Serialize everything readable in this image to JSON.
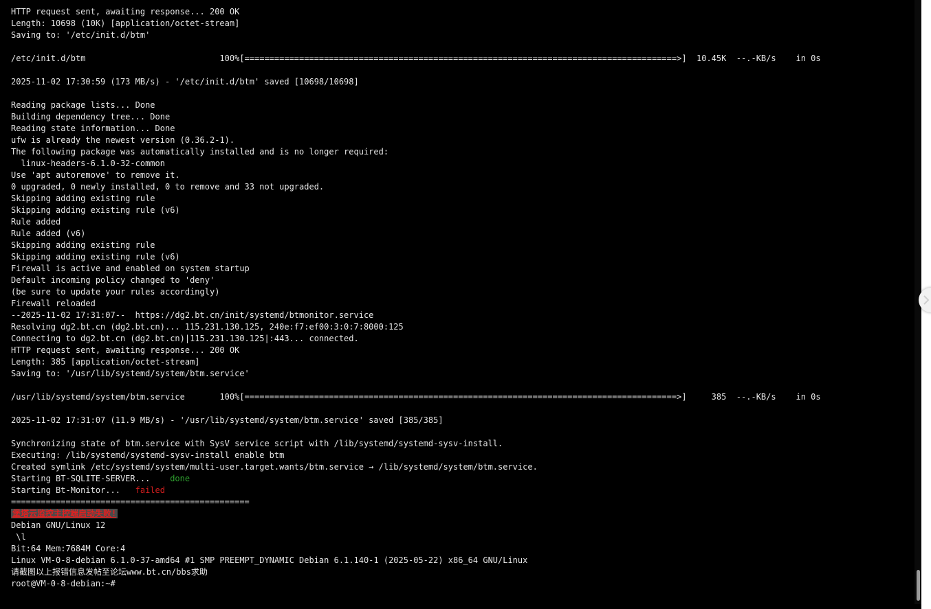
{
  "terminal": {
    "lines": [
      "HTTP request sent, awaiting response... 200 OK",
      "Length: 10698 (10K) [application/octet-stream]",
      "Saving to: '/etc/init.d/btm'",
      "",
      "/etc/init.d/btm                           100%[=======================================================================================>]  10.45K  --.-KB/s    in 0s",
      "",
      "2025-11-02 17:30:59 (173 MB/s) - '/etc/init.d/btm' saved [10698/10698]",
      "",
      "Reading package lists... Done",
      "Building dependency tree... Done",
      "Reading state information... Done",
      "ufw is already the newest version (0.36.2-1).",
      "The following package was automatically installed and is no longer required:",
      "  linux-headers-6.1.0-32-common",
      "Use 'apt autoremove' to remove it.",
      "0 upgraded, 0 newly installed, 0 to remove and 33 not upgraded.",
      "Skipping adding existing rule",
      "Skipping adding existing rule (v6)",
      "Rule added",
      "Rule added (v6)",
      "Skipping adding existing rule",
      "Skipping adding existing rule (v6)",
      "Firewall is active and enabled on system startup",
      "Default incoming policy changed to 'deny'",
      "(be sure to update your rules accordingly)",
      "Firewall reloaded",
      "--2025-11-02 17:31:07--  https://dg2.bt.cn/init/systemd/btmonitor.service",
      "Resolving dg2.bt.cn (dg2.bt.cn)... 115.231.130.125, 240e:f7:ef00:3:0:7:8000:125",
      "Connecting to dg2.bt.cn (dg2.bt.cn)|115.231.130.125|:443... connected.",
      "HTTP request sent, awaiting response... 200 OK",
      "Length: 385 [application/octet-stream]",
      "Saving to: '/usr/lib/systemd/system/btm.service'",
      "",
      "/usr/lib/systemd/system/btm.service       100%[=======================================================================================>]     385  --.-KB/s    in 0s",
      "",
      "2025-11-02 17:31:07 (11.9 MB/s) - '/usr/lib/systemd/system/btm.service' saved [385/385]",
      "",
      "Synchronizing state of btm.service with SysV service script with /lib/systemd/systemd-sysv-install.",
      "Executing: /lib/systemd/systemd-sysv-install enable btm",
      "Created symlink /etc/systemd/system/multi-user.target.wants/btm.service → /lib/systemd/system/btm.service."
    ],
    "sqlite_line": {
      "text": "Starting BT-SQLITE-SERVER...    ",
      "status": "done"
    },
    "monitor_line": {
      "text": "Starting Bt-Monitor...   ",
      "status": "failed"
    },
    "separator": "================================================",
    "error_banner": "堡塔云监控主控端启动失败!",
    "lines_after": [
      "Debian GNU/Linux 12",
      " \\l",
      "Bit:64 Mem:7684M Core:4",
      "Linux VM-0-8-debian 6.1.0-37-amd64 #1 SMP PREEMPT_DYNAMIC Debian 6.1.140-1 (2025-05-22) x86_64 GNU/Linux",
      "请截图以上报错信息发帖至论坛www.bt.cn/bbs求助"
    ],
    "prompt": "root@VM-0-8-debian:~# "
  },
  "colors": {
    "background": "#000000",
    "text": "#e6e6e6",
    "success": "#2fa12f",
    "error": "#d11e1e"
  },
  "icons": {
    "collapse_tab": "chevron-right-icon"
  }
}
